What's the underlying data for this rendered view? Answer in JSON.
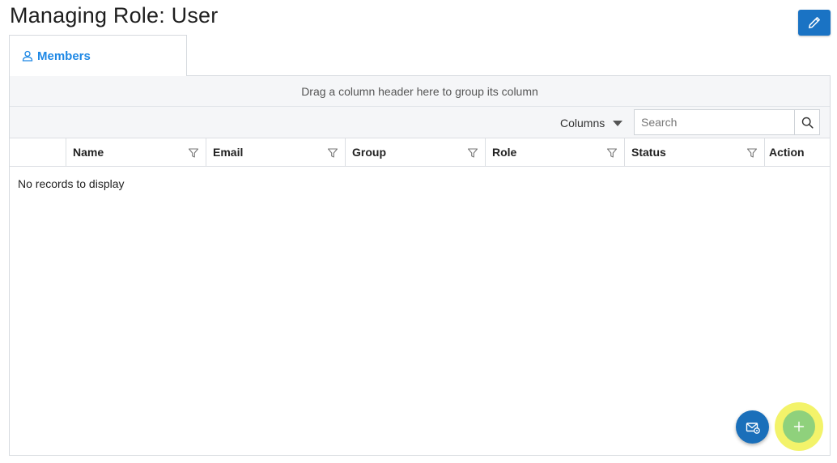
{
  "page": {
    "title": "Managing Role: User"
  },
  "tabs": [
    {
      "label": "Members",
      "icon": "user-icon",
      "active": true
    }
  ],
  "grid": {
    "group_hint": "Drag a column header here to group its column",
    "columns_button": "Columns",
    "search": {
      "placeholder": "Search",
      "value": ""
    },
    "headers": [
      "",
      "Name",
      "Email",
      "Group",
      "Role",
      "Status",
      "Action"
    ],
    "empty_message": "No records to display"
  },
  "actions": {
    "edit_icon": "pencil-icon",
    "mail_icon": "mail-settings-icon",
    "add_icon": "plus-icon"
  },
  "colors": {
    "accent": "#1e88e5",
    "edit_button": "#1a73c4",
    "mail_button": "#1a6fba",
    "add_button": "#8fd17c",
    "highlight": "#f3f36a"
  }
}
